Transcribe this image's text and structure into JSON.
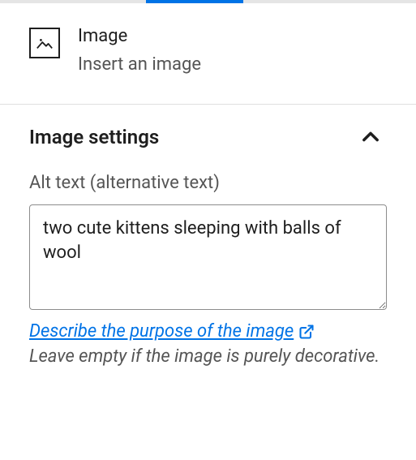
{
  "block": {
    "title": "Image",
    "description": "Insert an image"
  },
  "settings": {
    "title": "Image settings",
    "expanded": true,
    "alt": {
      "label": "Alt text (alternative text)",
      "value": "two cute kittens sleeping with balls of wool",
      "help_link": "Describe the purpose of the image",
      "help_text": "Leave empty if the image is purely decorative."
    }
  }
}
